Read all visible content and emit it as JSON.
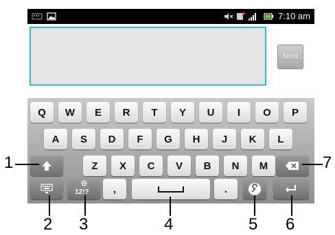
{
  "status_bar": {
    "time": "7:10 am",
    "icons": [
      "notification-icon",
      "image-icon",
      "mute-icon",
      "no-sim-icon",
      "signal-icon",
      "battery-icon"
    ]
  },
  "edit_area": {
    "next_label": "Next"
  },
  "keyboard": {
    "row1": [
      "Q",
      "W",
      "E",
      "R",
      "T",
      "Y",
      "U",
      "I",
      "O",
      "P"
    ],
    "row2": [
      "A",
      "S",
      "D",
      "F",
      "G",
      "H",
      "J",
      "K",
      "L"
    ],
    "row3": [
      "Z",
      "X",
      "C",
      "V",
      "B",
      "N",
      "M"
    ],
    "symbols_label": "12!?",
    "comma_label": ",",
    "period_label": "."
  },
  "callouts": [
    "1",
    "2",
    "3",
    "4",
    "5",
    "6",
    "7"
  ],
  "colors": {
    "accent": "#33b5e5",
    "keyboard_bg": "#a8a8a8"
  }
}
